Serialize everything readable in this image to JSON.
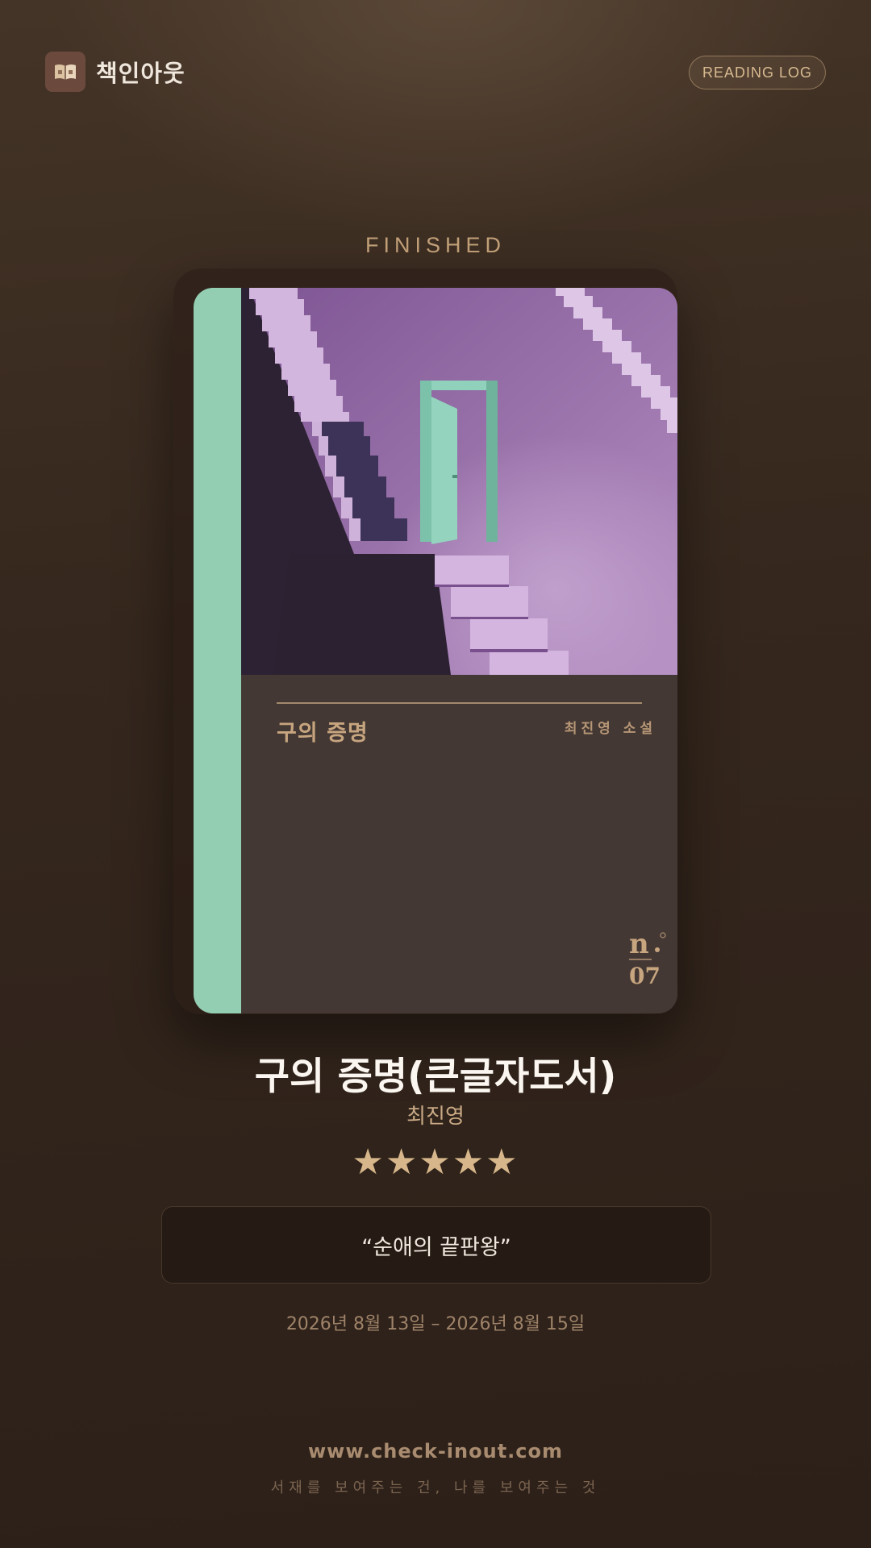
{
  "header": {
    "brand_icon": "open-book-icon",
    "brand_name": "책인아웃",
    "log_label": "READING LOG"
  },
  "status_label": "FINISHED",
  "book": {
    "cover": {
      "title": "구의 증명",
      "author_label": "최진영 소설",
      "series_mark": "n. 07",
      "spine_color": "#94ceb2",
      "accent_color": "#c7a57f"
    },
    "title": "구의 증명(큰글자도서)",
    "author": "최진영",
    "rating_display": "★★★★★",
    "rating": 5,
    "rating_max": 5,
    "quote": "“순애의 끝판왕”",
    "dates": "2026년 8월 13일 – 2026년 8월 15일"
  },
  "footer": {
    "site": "www.check-inout.com",
    "tagline": "서재를 보여주는 건, 나를 보여주는 것"
  },
  "colors": {
    "background": "#35271d",
    "accent": "#d6b68a"
  }
}
